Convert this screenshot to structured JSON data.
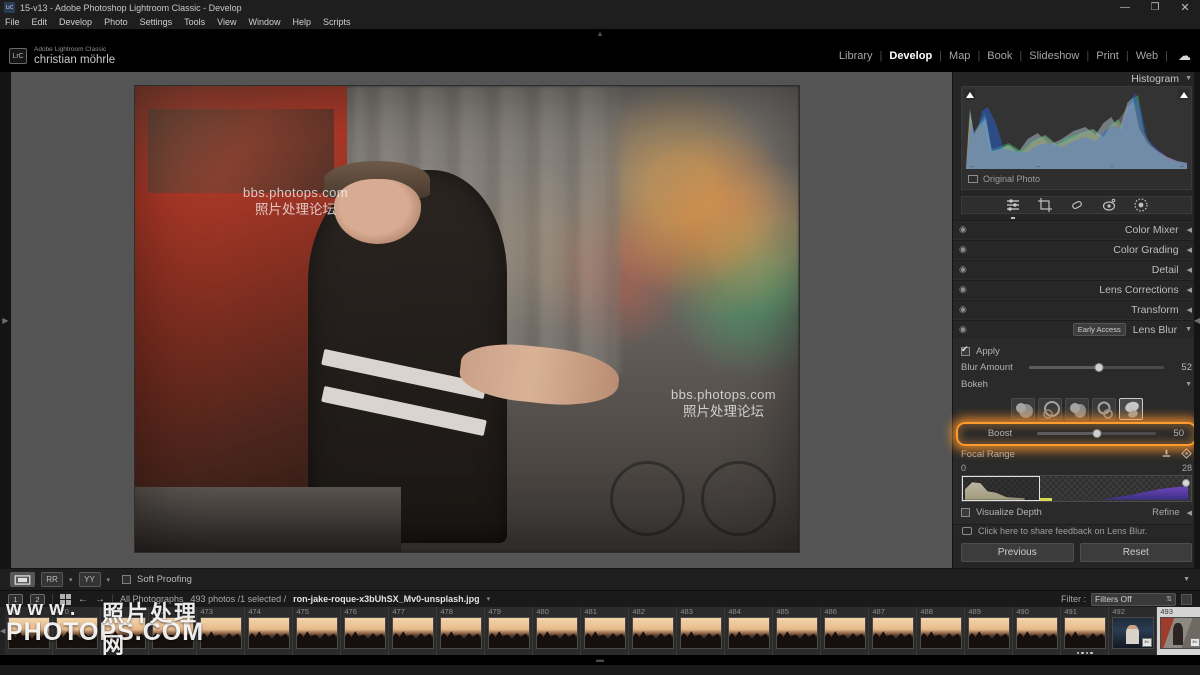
{
  "window": {
    "title": "15-v13 - Adobe Photoshop Lightroom Classic - Develop",
    "app_icon": "lrc-app-icon",
    "minimize": "—",
    "maximize": "❐",
    "close": "✕"
  },
  "menubar": {
    "items": [
      "File",
      "Edit",
      "Develop",
      "Photo",
      "Settings",
      "Tools",
      "View",
      "Window",
      "Help",
      "Scripts"
    ]
  },
  "identity": {
    "badge": "LrC",
    "product": "Adobe Lightroom Classic",
    "user": "christian möhrle"
  },
  "modules": {
    "items": [
      {
        "label": "Library",
        "active": false
      },
      {
        "label": "Develop",
        "active": true
      },
      {
        "label": "Map",
        "active": false
      },
      {
        "label": "Book",
        "active": false
      },
      {
        "label": "Slideshow",
        "active": false
      },
      {
        "label": "Print",
        "active": false
      },
      {
        "label": "Web",
        "active": false
      }
    ],
    "cloud_icon": "cloud-sync-icon"
  },
  "canvas": {
    "watermark_1": {
      "line1": "bbs.photops.com",
      "line2": "照片处理论坛"
    },
    "watermark_2": {
      "line1": "bbs.photops.com",
      "line2": "照片处理论坛"
    }
  },
  "right_panel": {
    "histogram": {
      "title": "Histogram",
      "collapse_arrow": "▼",
      "original_photo_label": "Original Photo"
    },
    "tools": [
      {
        "name": "basic-adjustments-icon",
        "glyph": "≋",
        "selected": true
      },
      {
        "name": "crop-overlay-icon",
        "glyph": "⛶",
        "selected": false
      },
      {
        "name": "healing-brush-icon",
        "glyph": "◗",
        "selected": false
      },
      {
        "name": "red-eye-icon",
        "glyph": "◉",
        "selected": false
      },
      {
        "name": "masking-icon",
        "glyph": "◍",
        "selected": false
      }
    ],
    "sections": [
      {
        "name": "Color Mixer",
        "arrow": "◀",
        "eye": "◉"
      },
      {
        "name": "Color Grading",
        "arrow": "◀",
        "eye": "◉"
      },
      {
        "name": "Detail",
        "arrow": "◀",
        "eye": "◉"
      },
      {
        "name": "Lens Corrections",
        "arrow": "◀",
        "eye": "◉"
      },
      {
        "name": "Transform",
        "arrow": "◀",
        "eye": "◉"
      }
    ],
    "lens_blur": {
      "title": "Lens Blur",
      "badge": "Early Access",
      "arrow": "▼",
      "eye": "◉",
      "apply_label": "Apply",
      "apply_checked": true,
      "blur_amount": {
        "label": "Blur Amount",
        "value": "52",
        "percent": 52
      },
      "bokeh": {
        "label": "Bokeh",
        "arrow": "▼"
      },
      "bokeh_shapes": [
        {
          "name": "bokeh-shape-circle",
          "selected": false
        },
        {
          "name": "bokeh-shape-bubble",
          "selected": false
        },
        {
          "name": "bokeh-shape-5blade",
          "selected": false
        },
        {
          "name": "bokeh-shape-ring",
          "selected": false
        },
        {
          "name": "bokeh-shape-cateye",
          "selected": true
        }
      ],
      "boost": {
        "label": "Boost",
        "value": "50",
        "percent": 50,
        "highlighted": true
      },
      "focal_range": {
        "label": "Focal Range",
        "min": "0",
        "max": "28",
        "picker_icon": "depth-picker-icon",
        "target_icon": "focus-target-icon"
      },
      "visualize_depth": {
        "label": "Visualize Depth",
        "checked": false
      },
      "refine": {
        "label": "Refine",
        "arrow": "◀"
      },
      "feedback": {
        "label": "Click here to share feedback on Lens Blur.",
        "icon": "speech-bubble-icon"
      }
    },
    "buttons": {
      "previous": "Previous",
      "reset": "Reset"
    }
  },
  "toolbar": {
    "view_loupe": {
      "name": "loupe-view-icon",
      "selected": true
    },
    "view_compare": {
      "name": "compare-view-icon",
      "label": "RR"
    },
    "view_before_after": {
      "name": "before-after-view-icon",
      "label": "YY"
    },
    "soft_proofing": {
      "label": "Soft Proofing",
      "checked": false
    },
    "collapse_arrow": "▼"
  },
  "filmstrip_header": {
    "screen1": "1",
    "screen2": "2",
    "grid_icon": "grid-view-icon",
    "back_arrow": "←",
    "forward_arrow": "→",
    "source": "All Photographs",
    "count": "493 photos /1 selected /",
    "filename": "ron-jake-roque-x3bUhSX_Mv0-unsplash.jpg",
    "filename_caret": "▾",
    "filter_label": "Filter :",
    "filter_value": "Filters Off",
    "lock_icon": "filter-lock-icon"
  },
  "filmstrip": {
    "left_arrow": "◀",
    "thumbnails": [
      {
        "index": "469",
        "kind": "sunset",
        "selected": false,
        "rating": 0
      },
      {
        "index": "470",
        "kind": "sunset",
        "selected": false,
        "rating": 0
      },
      {
        "index": "471",
        "kind": "sunset",
        "selected": false,
        "rating": 0
      },
      {
        "index": "472",
        "kind": "sunset",
        "selected": false,
        "rating": 0
      },
      {
        "index": "473",
        "kind": "sunset",
        "selected": false,
        "rating": 0
      },
      {
        "index": "474",
        "kind": "sunset",
        "selected": false,
        "rating": 0
      },
      {
        "index": "475",
        "kind": "sunset",
        "selected": false,
        "rating": 0
      },
      {
        "index": "476",
        "kind": "sunset",
        "selected": false,
        "rating": 0
      },
      {
        "index": "477",
        "kind": "sunset",
        "selected": false,
        "rating": 0
      },
      {
        "index": "478",
        "kind": "sunset",
        "selected": false,
        "rating": 0
      },
      {
        "index": "479",
        "kind": "sunset",
        "selected": false,
        "rating": 0
      },
      {
        "index": "480",
        "kind": "sunset",
        "selected": false,
        "rating": 0
      },
      {
        "index": "481",
        "kind": "sunset",
        "selected": false,
        "rating": 0
      },
      {
        "index": "482",
        "kind": "sunset",
        "selected": false,
        "rating": 0
      },
      {
        "index": "483",
        "kind": "sunset",
        "selected": false,
        "rating": 0
      },
      {
        "index": "484",
        "kind": "sunset",
        "selected": false,
        "rating": 0
      },
      {
        "index": "485",
        "kind": "sunset",
        "selected": false,
        "rating": 0
      },
      {
        "index": "486",
        "kind": "sunset",
        "selected": false,
        "rating": 0
      },
      {
        "index": "487",
        "kind": "sunset",
        "selected": false,
        "rating": 0
      },
      {
        "index": "488",
        "kind": "sunset",
        "selected": false,
        "rating": 0
      },
      {
        "index": "489",
        "kind": "sunset",
        "selected": false,
        "rating": 0
      },
      {
        "index": "490",
        "kind": "sunset",
        "selected": false,
        "rating": 0
      },
      {
        "index": "491",
        "kind": "sunset",
        "selected": false,
        "rating": 4
      },
      {
        "index": "492",
        "kind": "portrait",
        "selected": false,
        "rating": 0
      },
      {
        "index": "493",
        "kind": "street",
        "selected": true,
        "rating": 0
      }
    ],
    "thumb_badge": "✄"
  },
  "page_watermark": {
    "top": "www.",
    "bottom": "PHOTOPS.COM",
    "chinese": "照片处理网"
  },
  "colors": {
    "accent_highlight": "#ff9a2e",
    "panel_bg": "#252525",
    "canvas_bg": "#545454",
    "text_primary": "#c6c6c6"
  }
}
